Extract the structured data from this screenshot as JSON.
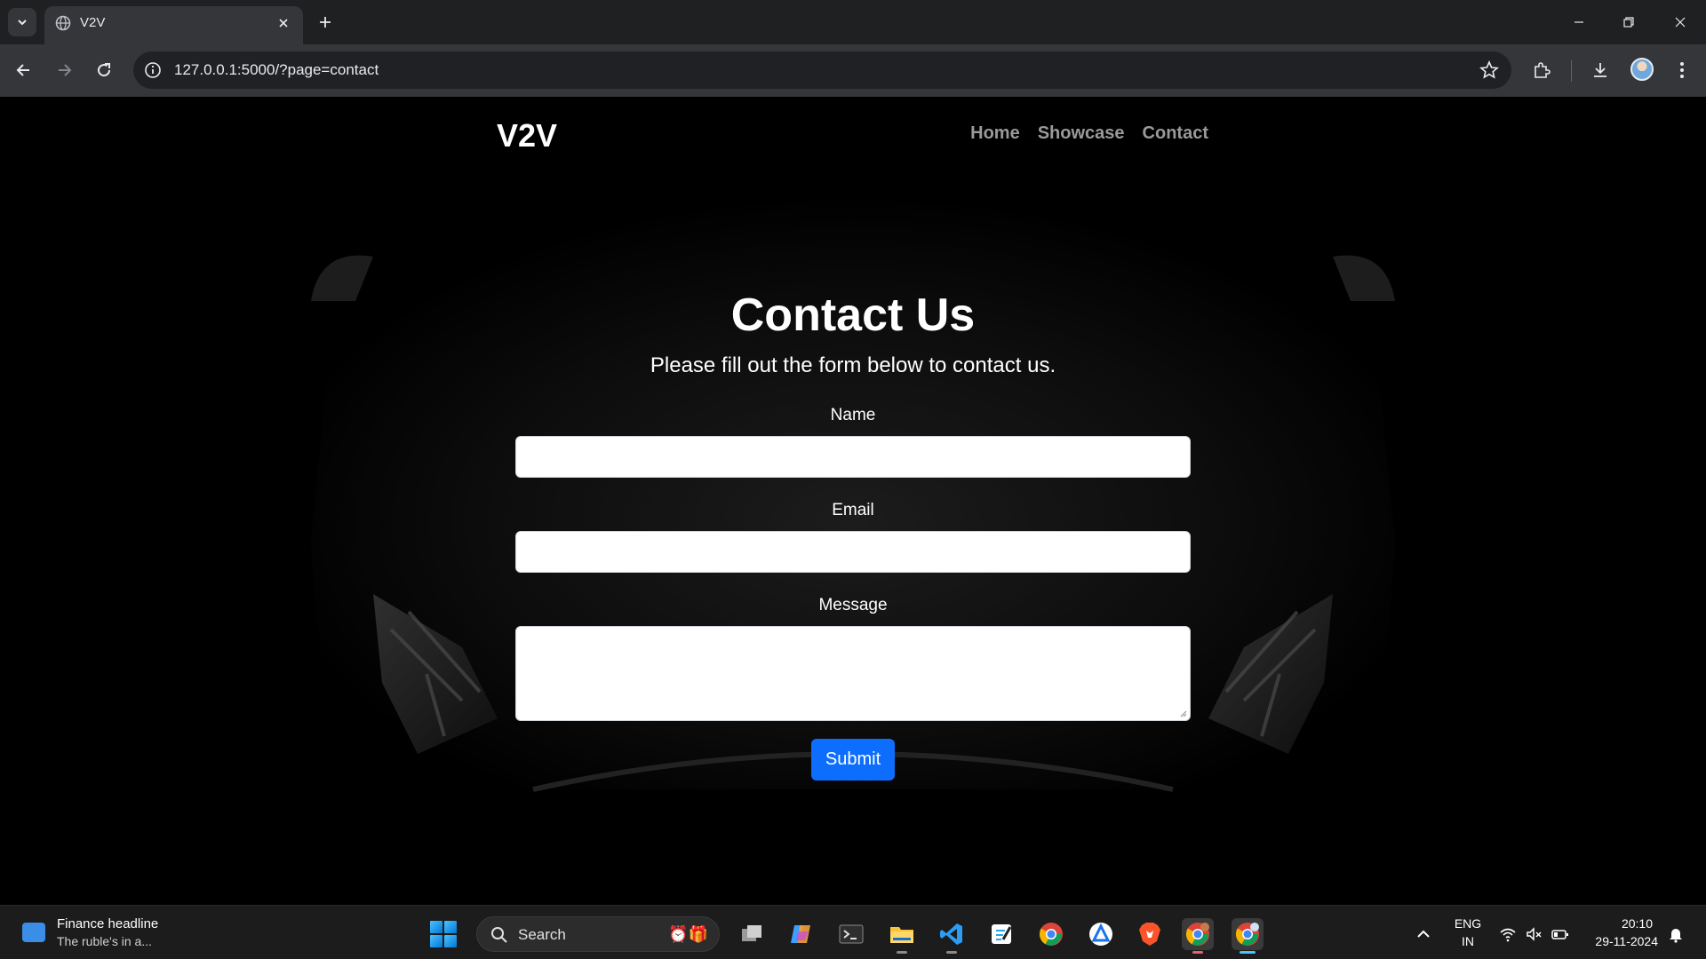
{
  "browser": {
    "tab_title": "V2V",
    "url": "127.0.0.1:5000/?page=contact"
  },
  "site": {
    "brand": "V2V",
    "nav": [
      "Home",
      "Showcase",
      "Contact"
    ]
  },
  "contact": {
    "heading": "Contact Us",
    "subtitle": "Please fill out the form below to contact us.",
    "name_label": "Name",
    "name_value": "",
    "email_label": "Email",
    "email_value": "",
    "message_label": "Message",
    "message_value": "",
    "submit_label": "Submit",
    "submit_color": "#0d6efd"
  },
  "taskbar": {
    "widget_title": "Finance headline",
    "widget_subtitle": "The ruble's in a...",
    "search_label": "Search",
    "apps": [
      "task-view-icon",
      "copilot-icon",
      "terminal-icon",
      "file-explorer-icon",
      "vscode-icon",
      "notepad-icon",
      "chrome-icon",
      "app-store-icon",
      "brave-icon",
      "chrome-profile-icon",
      "chrome-canary-icon"
    ],
    "language": "ENG",
    "region": "IN",
    "time": "20:10",
    "date": "29-11-2024"
  }
}
